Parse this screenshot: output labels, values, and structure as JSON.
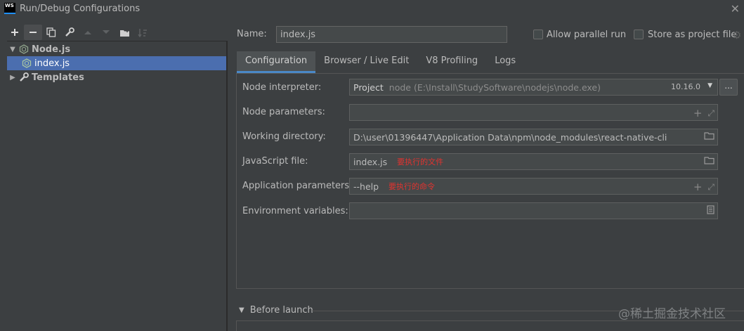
{
  "window": {
    "app_badge": "WS",
    "title": "Run/Debug Configurations"
  },
  "toolbar": {
    "buttons": [
      "add-icon",
      "remove-icon",
      "copy-icon",
      "wrench-icon",
      "move-up-icon",
      "move-down-icon",
      "new-folder-icon",
      "sort-icon"
    ]
  },
  "tree": {
    "nodejs_label": "Node.js",
    "indexjs_label": "index.js",
    "templates_label": "Templates"
  },
  "name_field": {
    "label": "Name:",
    "value": "index.js"
  },
  "options": {
    "allow_parallel": "Allow parallel run",
    "store_project": "Store as project file"
  },
  "tabs": [
    {
      "label": "Configuration"
    },
    {
      "label": "Browser / Live Edit"
    },
    {
      "label": "V8 Profiling"
    },
    {
      "label": "Logs"
    }
  ],
  "form": {
    "interpreter": {
      "label": "Node interpreter:",
      "project": "Project",
      "path": "node (E:\\Install\\StudySoftware\\nodejs\\node.exe)",
      "version": "10.16.0",
      "more": "..."
    },
    "node_params": {
      "label": "Node parameters:",
      "value": ""
    },
    "working_dir": {
      "label": "Working directory:",
      "value": "D:\\user\\01396447\\Application Data\\npm\\node_modules\\react-native-cli"
    },
    "js_file": {
      "label": "JavaScript file:",
      "value": "index.js",
      "note": "要执行的文件"
    },
    "app_params": {
      "label": "Application parameters:",
      "value": "--help",
      "note": "要执行的命令"
    },
    "env_vars": {
      "label": "Environment variables:",
      "value": ""
    }
  },
  "before_launch": {
    "label": "Before launch"
  },
  "watermark": "@稀土掘金技术社区",
  "colors": {
    "background": "#3c3f41",
    "selection": "#4b6eaf",
    "tab_underline": "#4a88c7",
    "annotation": "#e0332f"
  }
}
